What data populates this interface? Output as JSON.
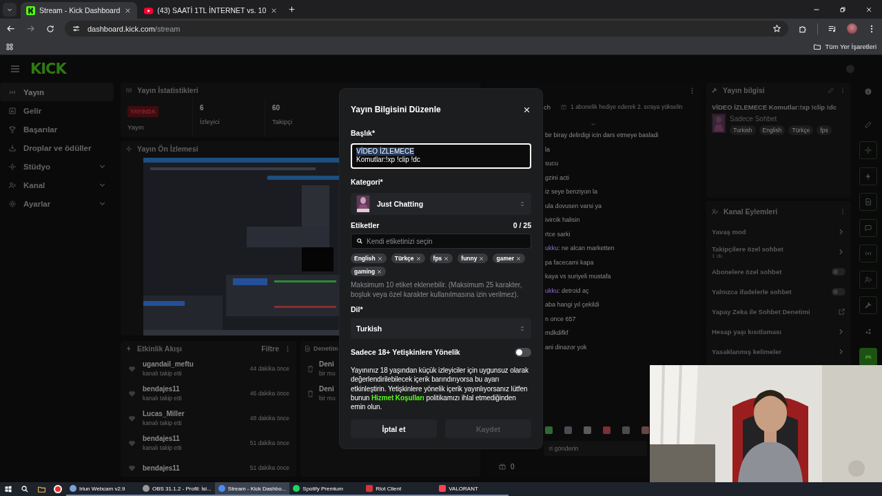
{
  "browser": {
    "tabs": [
      {
        "title": "Stream - Kick Dashboard",
        "selected": true
      },
      {
        "title": "(43) SAATİ 1TL İNTERNET vs. 10",
        "selected": false
      }
    ],
    "url_host": "dashboard.kick.com",
    "url_path": "/stream",
    "bookmarks_label": "Tüm Yer İşaretleri"
  },
  "header": {
    "logo": "KICK"
  },
  "sidebar": {
    "items": [
      {
        "label": "Yayın",
        "selected": true,
        "expandable": false
      },
      {
        "label": "Gelir",
        "selected": false,
        "expandable": false
      },
      {
        "label": "Başarılar",
        "selected": false,
        "expandable": false
      },
      {
        "label": "Droplar ve ödüller",
        "selected": false,
        "expandable": false
      },
      {
        "label": "Stüdyo",
        "selected": false,
        "expandable": true
      },
      {
        "label": "Kanal",
        "selected": false,
        "expandable": true
      },
      {
        "label": "Ayarlar",
        "selected": false,
        "expandable": true
      }
    ]
  },
  "stats": {
    "title": "Yayın İstatistikleri",
    "status_badge": "YAYINDA",
    "status_label": "Yayın",
    "counts": [
      {
        "value": "6",
        "label": "İzleyici"
      },
      {
        "value": "60",
        "label": "Takipçi"
      }
    ]
  },
  "preview": {
    "title": "Yayın Ön İzlemesi"
  },
  "activity": {
    "title": "Etkinlik Akışı",
    "filter": "Filtre",
    "events": [
      {
        "user": "ugandail_meftu",
        "action": "kanalı takip etti",
        "time": "44 dakika önce"
      },
      {
        "user": "bendajes11",
        "action": "kanalı takip etti",
        "time": "46 dakika önce"
      },
      {
        "user": "Lucas_Miller",
        "action": "kanalı takip etti",
        "time": "48 dakika önce"
      },
      {
        "user": "bendajes11",
        "action": "kanalı takip etti",
        "time": "51 dakika önce"
      },
      {
        "user": "bendajes11",
        "time": "51 dakika önce"
      }
    ]
  },
  "moderation": {
    "title": "Denetim",
    "entries": [
      {
        "user": "Deni",
        "detail": "bir mo"
      },
      {
        "user": "Deni",
        "detail": "bir mo"
      }
    ]
  },
  "chat": {
    "header": "ch",
    "goal": "1 abonelik hediye ederek 2. sıraya yükselin",
    "messages": [
      {
        "text": "bir biray delirdigi icin dars etmeye basladi"
      },
      {
        "text": "la"
      },
      {
        "text": "sucu"
      },
      {
        "text": "gzini acti"
      },
      {
        "text": "iz seye benziyon la"
      },
      {
        "text": "ula dovusen varsi ya"
      },
      {
        "text": "ivircik halisin"
      },
      {
        "text": "rtce sarki"
      },
      {
        "user": "ukku",
        "text": ": ne alcan marketten"
      },
      {
        "text": "pa facecami kapa"
      },
      {
        "text": "kaya vs suriyeli mustafa"
      },
      {
        "user": "ukku",
        "text": ": detroid aç"
      },
      {
        "text": "aba hangi yıl çekildi"
      },
      {
        "text": "n once 657"
      },
      {
        "text": "mdkdifkf"
      },
      {
        "text": "ani dinazor yok"
      }
    ],
    "input_placeholder": "ri gönderin",
    "gift_count": "0"
  },
  "stream_info": {
    "title": "Yayın bilgisi",
    "stream_title": "VİDEO İZLEMECE Komutlar:!xp !clip !dc",
    "category": "Sadece Sohbet",
    "tags": [
      "Turkish",
      "English",
      "Türkçe",
      "fps"
    ]
  },
  "channel_actions": {
    "title": "Kanal Eylemleri",
    "items": [
      {
        "label": "Yavaş mod",
        "kind": "link"
      },
      {
        "label": "Takipçilere özel sohbet",
        "kind": "link",
        "detail": "1 dk."
      },
      {
        "label": "Abonelere özel sohbet",
        "kind": "toggle",
        "on": false
      },
      {
        "label": "Yalnızca ifadelerle sohbet",
        "kind": "toggle",
        "on": false
      },
      {
        "label": "Yapay Zeka ile Sohbet Denetimi",
        "kind": "external"
      },
      {
        "label": "Hesap yaşı kısıtlaması",
        "kind": "link"
      },
      {
        "label": "Yasaklanmış kelimeler",
        "kind": "link"
      }
    ]
  },
  "quick_actions": [
    {
      "kind": "plain",
      "highlighted": false
    },
    {
      "kind": "plain",
      "highlighted": false
    },
    {
      "kind": "boxed",
      "highlighted": false
    },
    {
      "kind": "boxed",
      "highlighted": false
    },
    {
      "kind": "boxed",
      "highlighted": false
    },
    {
      "kind": "boxed",
      "highlighted": false
    },
    {
      "kind": "boxed",
      "highlighted": false
    },
    {
      "kind": "boxed",
      "highlighted": false
    },
    {
      "kind": "boxed",
      "highlighted": false
    },
    {
      "kind": "plain",
      "highlighted": false
    },
    {
      "kind": "boxed",
      "highlighted": true
    }
  ],
  "modal": {
    "title": "Yayın Bilgisini Düzenle",
    "title_label": "Başlık*",
    "title_lines": [
      {
        "text": "VİDEO İZLEMECE",
        "selected": true
      },
      {
        "text": "Komutlar:!xp !clip !dc",
        "selected": false
      }
    ],
    "category_label": "Kategori*",
    "category": "Just Chatting",
    "tags_label": "Etiketler",
    "tags_count": "0 / 25",
    "tags_placeholder": "Kendi etiketinizi seçin",
    "tags": [
      "English",
      "Türkçe",
      "fps",
      "funny",
      "gamer",
      "gaming"
    ],
    "tags_hint": "Maksimum 10 etiket eklenebilir. (Maksimum 25 karakter, boşluk veya özel karakter kullanılmasına izin verilmez).",
    "language_label": "Dil*",
    "language": "Turkish",
    "mature_label": "Sadece 18+ Yetişkinlere Yönelik",
    "mature_on": false,
    "mature_text_before": "Yayınınız 18 yaşından küçük izleyiciler için uygunsuz olarak değerlendirilebilecek içerik barındırıyorsa bu ayarı etkinleştirin. Yetişkinlere yönelik içerik yayınlıyorsanız lütfen bunun ",
    "terms_link": "Hizmet Koşulları",
    "mature_text_after": " politikamızı ihlal etmediğinden emin olun.",
    "cancel": "İptal et",
    "save": "Kaydet",
    "save_disabled": true
  },
  "taskbar": {
    "apps": [
      {
        "label": "Iriun Webcam v2.9",
        "selected": false
      },
      {
        "label": "OBS 31.1.2 - Profil: İsi...",
        "selected": false
      },
      {
        "label": "Stream - Kick Dashbo...",
        "selected": true
      },
      {
        "label": "Spotify Premium",
        "selected": false
      },
      {
        "label": "Riot Client",
        "selected": false
      },
      {
        "label": "VALORANT",
        "selected": false
      }
    ]
  }
}
